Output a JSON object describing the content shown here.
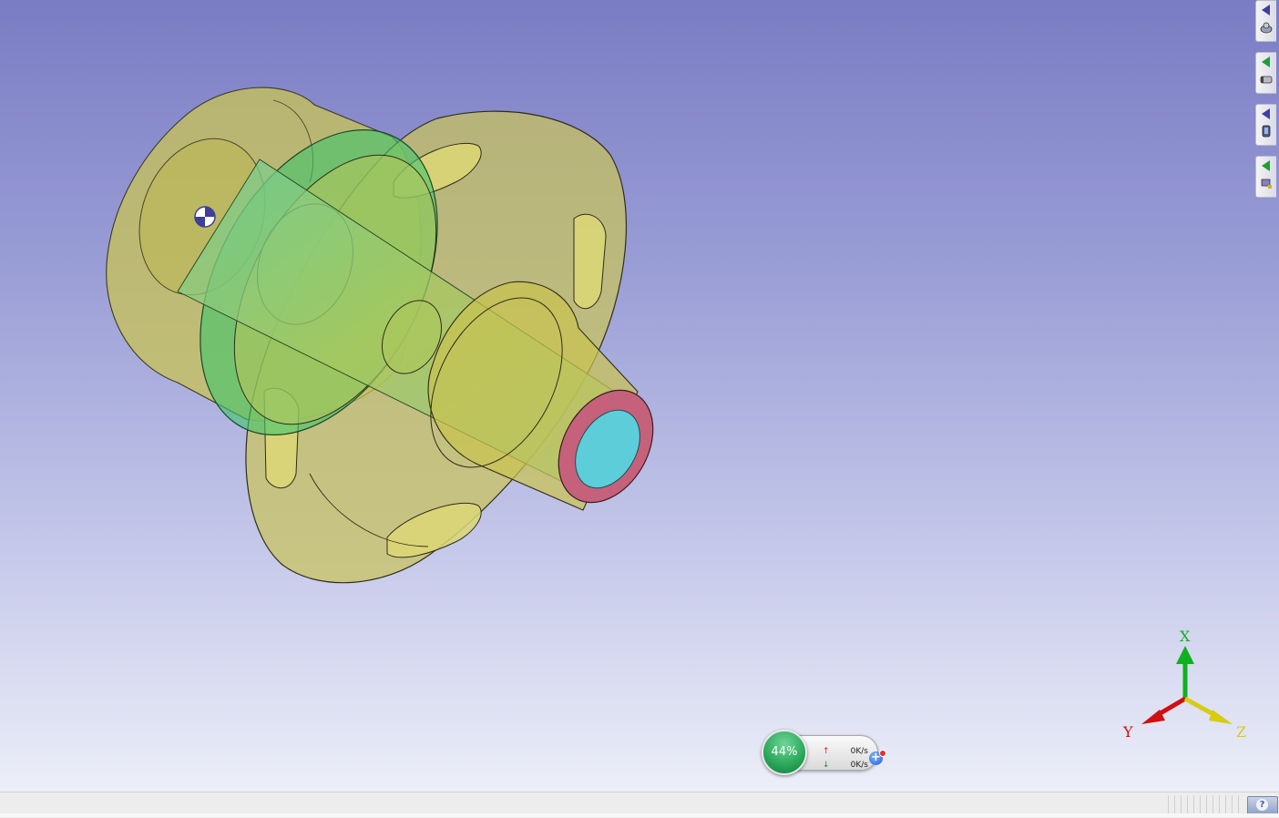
{
  "viewport": {
    "background_top": "#7a7cc4",
    "background_bottom": "#eceef8",
    "model": {
      "body_color": "#c8c45a",
      "flange_ring_color": "#3fc56a",
      "bore_color": "#5ccdd9",
      "end_face_color": "#c5617a",
      "center_marker_icon": "rotation-center-icon"
    }
  },
  "triad": {
    "x_label": "X",
    "y_label": "Y",
    "z_label": "Z",
    "x_color": "#10b020",
    "y_color": "#d01010",
    "z_color": "#d6cc10"
  },
  "side_toolbar": {
    "groups": [
      {
        "arrow_color": "#3b3fa0",
        "icon": "view-orientation-icon"
      },
      {
        "arrow_color": "#1ca032",
        "icon": "display-style-icon"
      },
      {
        "arrow_color": "#3b3fa0",
        "icon": "material-icon"
      },
      {
        "arrow_color": "#1ca032",
        "icon": "tools-icon"
      }
    ]
  },
  "net_widget": {
    "percent": "44%",
    "upload": "0K/s",
    "download": "0K/s",
    "up_arrow": "↑",
    "down_arrow": "↓",
    "plus": "+"
  },
  "statusbar": {
    "help_glyph": "?"
  }
}
